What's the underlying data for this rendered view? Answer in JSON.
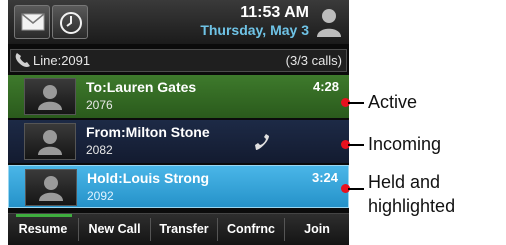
{
  "status_bar": {
    "time": "11:53 AM",
    "date": "Thursday, May 3",
    "icons": [
      "envelope-icon",
      "clock-icon",
      "user-icon"
    ]
  },
  "line": {
    "label": "Line:2091",
    "count": "(3/3 calls)",
    "icon": "phone-handset-icon"
  },
  "calls": [
    {
      "name": "To:Lauren Gates",
      "number": "2076",
      "timer": "4:28",
      "state_color": "#3e7a2c"
    },
    {
      "name": "From:Milton Stone",
      "number": "2082",
      "timer": "",
      "icon": "ringing-handset-icon",
      "state_color": "#1d2a46"
    },
    {
      "name": "Hold:Louis Strong",
      "number": "2092",
      "timer": "3:24",
      "state_color": "#4ab6e8"
    }
  ],
  "softkeys": [
    "Resume",
    "New Call",
    "Transfer",
    "Confrnc",
    "Join"
  ],
  "callouts": [
    "Active",
    "Incoming",
    "Held and\nhighlighted"
  ],
  "colors": {
    "callout_dot": "#e8111e",
    "date_text": "#6fc3e6"
  }
}
